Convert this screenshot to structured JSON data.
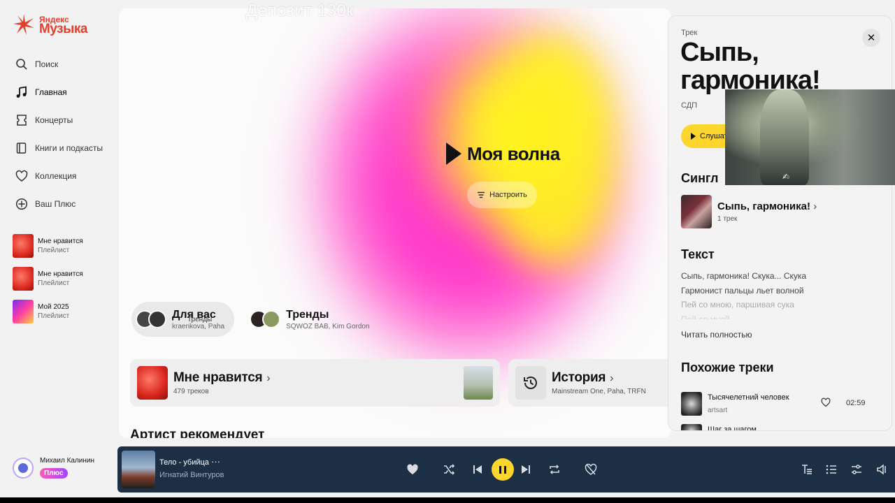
{
  "brand": {
    "line1": "Яндекс",
    "line2": "Музыка"
  },
  "overlay_text": "Депозит 130к",
  "nav": [
    {
      "label": "Поиск",
      "icon": "search-icon"
    },
    {
      "label": "Главная",
      "icon": "music-note-icon"
    },
    {
      "label": "Концерты",
      "icon": "ticket-icon"
    },
    {
      "label": "Книги и подкасты",
      "icon": "book-icon"
    },
    {
      "label": "Коллекция",
      "icon": "heart-icon"
    },
    {
      "label": "Ваш Плюс",
      "icon": "plus-circle-icon"
    }
  ],
  "playlists": [
    {
      "title": "Мне нравится",
      "sub": "Плейлист"
    },
    {
      "title": "Мне нравится",
      "sub": "Плейлист"
    },
    {
      "title": "Мой 2025",
      "sub": "Плейлист"
    }
  ],
  "user": {
    "name": "Михаил Калинин",
    "badge": "Плюс"
  },
  "main": {
    "wave_title": "Моя волна",
    "tune_label": "Настроить",
    "mixes": [
      {
        "title": "Для вас",
        "sub": "kraenkova, Paha",
        "overlap": "Тренды"
      },
      {
        "title": "Тренды",
        "sub": "SQWOZ BAB, Kim Gordon"
      }
    ],
    "liked_card": {
      "title": "Мне нравится",
      "sub": "479 треков"
    },
    "history_card": {
      "title": "История",
      "sub": "Mainstream One, Paha, TRFN"
    },
    "section_title": "Артист рекомендует"
  },
  "panel": {
    "kind": "Трек",
    "title": "Сыпь, гармоника!",
    "artist": "СДП",
    "listen_label": "Слушать",
    "single_heading": "Сингл",
    "single": {
      "title": "Сыпь, гармоника!",
      "sub": "1 трек"
    },
    "lyrics_heading": "Текст",
    "lyrics": [
      "Сыпь, гармоника! Скука... Скука",
      "Гармонист пальцы льет волной",
      "Пей со мною, паршивая сука",
      "Пей со мной ..."
    ],
    "read_full": "Читать полностью",
    "similar_heading": "Похожие треки",
    "similar": [
      {
        "title": "Тысячелетний человек",
        "artist": "artsart",
        "duration": "02:59"
      },
      {
        "title": "Шаг за шагом"
      }
    ]
  },
  "player": {
    "title": "Тело - убийца",
    "more": "···",
    "artist": "Игнатий Винтуров"
  },
  "colors": {
    "accent": "#fcd52d",
    "brand": "#e63e2c",
    "player_bg": "#1c2f44"
  }
}
